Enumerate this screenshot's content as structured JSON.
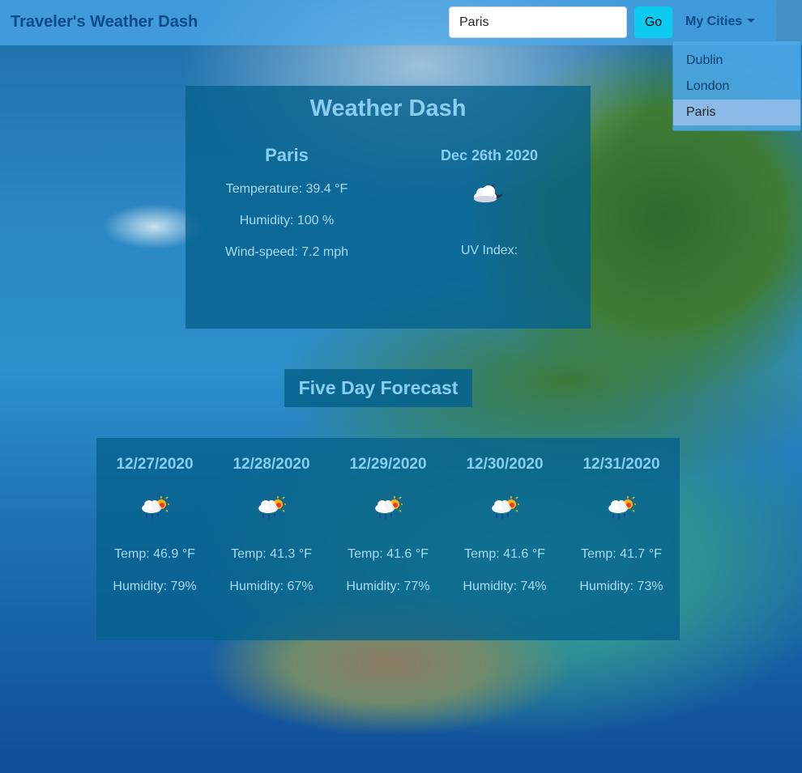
{
  "navbar": {
    "brand": "Traveler's Weather Dash",
    "search_value": "Paris",
    "go_label": "Go",
    "my_cities_label": "My Cities"
  },
  "dropdown": {
    "items": [
      {
        "label": "Dublin"
      },
      {
        "label": "London"
      },
      {
        "label": "Paris"
      }
    ],
    "active": "Paris"
  },
  "current": {
    "title": "Weather Dash",
    "city": "Paris",
    "date": "Dec 26th 2020",
    "temperature": "Temperature: 39.4 °F",
    "humidity": "Humidity: 100 %",
    "wind": "Wind-speed: 7.2 mph",
    "uv": "UV Index:",
    "icon": "cloudy-night-icon"
  },
  "forecast": {
    "title": "Five Day Forecast",
    "days": [
      {
        "date": "12/27/2020",
        "temp": "Temp: 46.9 °F",
        "humidity": "Humidity: 79%",
        "icon": "rain-sun-icon"
      },
      {
        "date": "12/28/2020",
        "temp": "Temp: 41.3 °F",
        "humidity": "Humidity: 67%",
        "icon": "rain-sun-icon"
      },
      {
        "date": "12/29/2020",
        "temp": "Temp: 41.6 °F",
        "humidity": "Humidity: 77%",
        "icon": "rain-sun-icon"
      },
      {
        "date": "12/30/2020",
        "temp": "Temp: 41.6 °F",
        "humidity": "Humidity: 74%",
        "icon": "rain-sun-icon"
      },
      {
        "date": "12/31/2020",
        "temp": "Temp: 41.7 °F",
        "humidity": "Humidity: 73%",
        "icon": "rain-sun-icon"
      }
    ]
  },
  "colors": {
    "navbar": "#4eaaeb",
    "panel": "#06628c",
    "heading": "#87cef0",
    "text": "#a6dcf5",
    "go_button": "#0dcaf0",
    "brand": "#0d4a8a"
  }
}
